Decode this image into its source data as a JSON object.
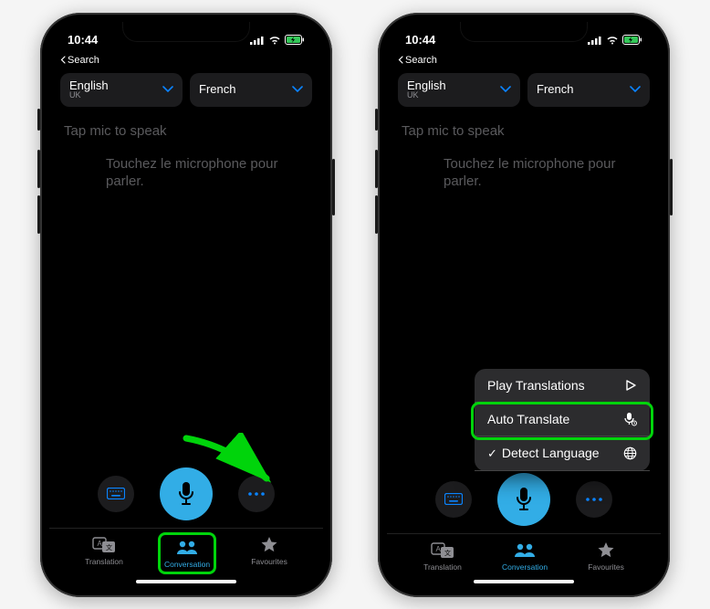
{
  "status": {
    "time": "10:44",
    "back": "Search"
  },
  "languages": {
    "left": {
      "name": "English",
      "sub": "UK"
    },
    "right": {
      "name": "French",
      "sub": ""
    }
  },
  "prompts": {
    "en": "Tap mic to speak",
    "fr": "Touchez le microphone pour parler."
  },
  "tabs": {
    "translation": "Translation",
    "conversation": "Conversation",
    "favourites": "Favourites"
  },
  "popup": {
    "play": "Play Translations",
    "auto": "Auto Translate",
    "detect": "Detect Language"
  },
  "icons": {
    "mic": "mic-icon",
    "keyboard": "keyboard-icon",
    "more": "more-icon"
  },
  "colors": {
    "accent": "#32ade6",
    "highlight": "#00d40b"
  }
}
